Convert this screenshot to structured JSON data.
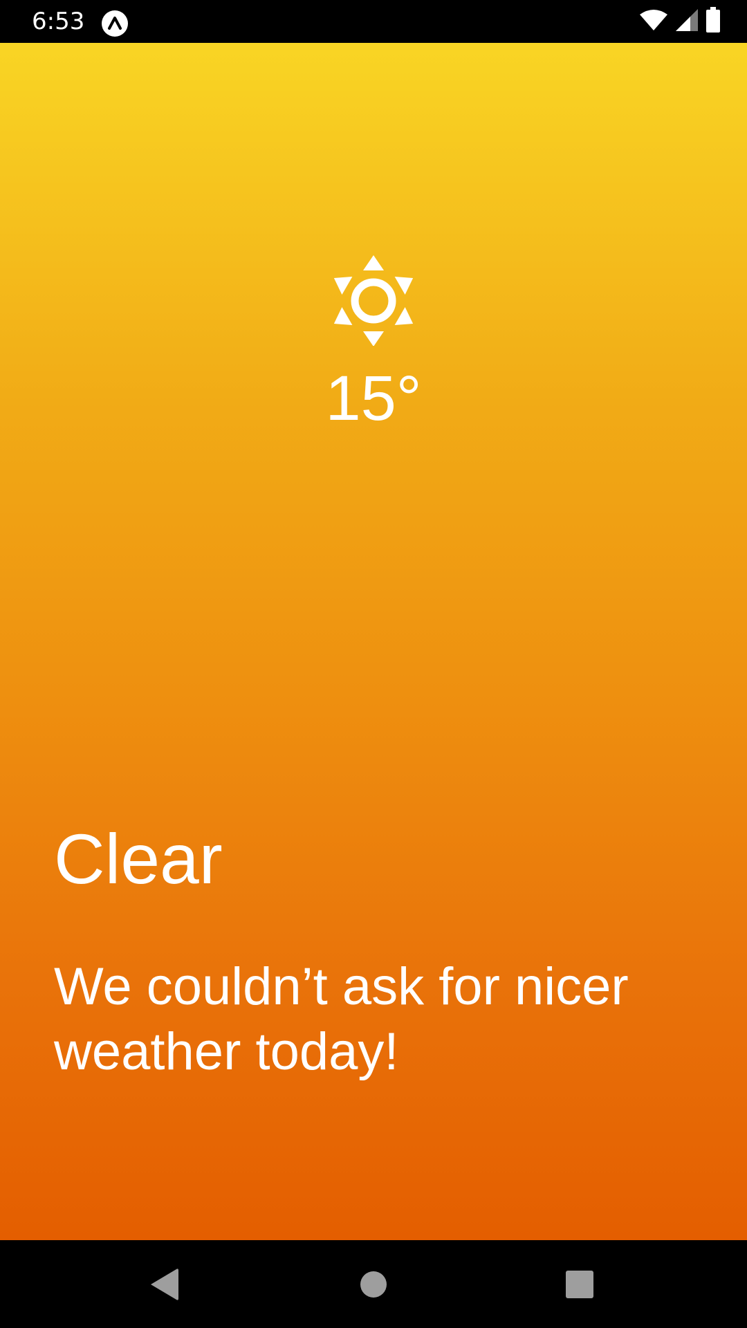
{
  "status_bar": {
    "time": "6:53",
    "app_icon": "expo-icon",
    "icons": [
      "wifi-icon",
      "signal-icon",
      "battery-icon"
    ]
  },
  "weather": {
    "icon": "sun-icon",
    "temperature": "15°",
    "condition": "Clear",
    "message": "We couldn’t ask for nicer weather today!"
  },
  "colors": {
    "gradient_top": "#f9d524",
    "gradient_bottom": "#e45e00",
    "text": "#ffffff",
    "nav_button": "#9e9e9e"
  },
  "nav_bar": {
    "buttons": [
      "back-icon",
      "home-icon",
      "recents-icon"
    ]
  }
}
